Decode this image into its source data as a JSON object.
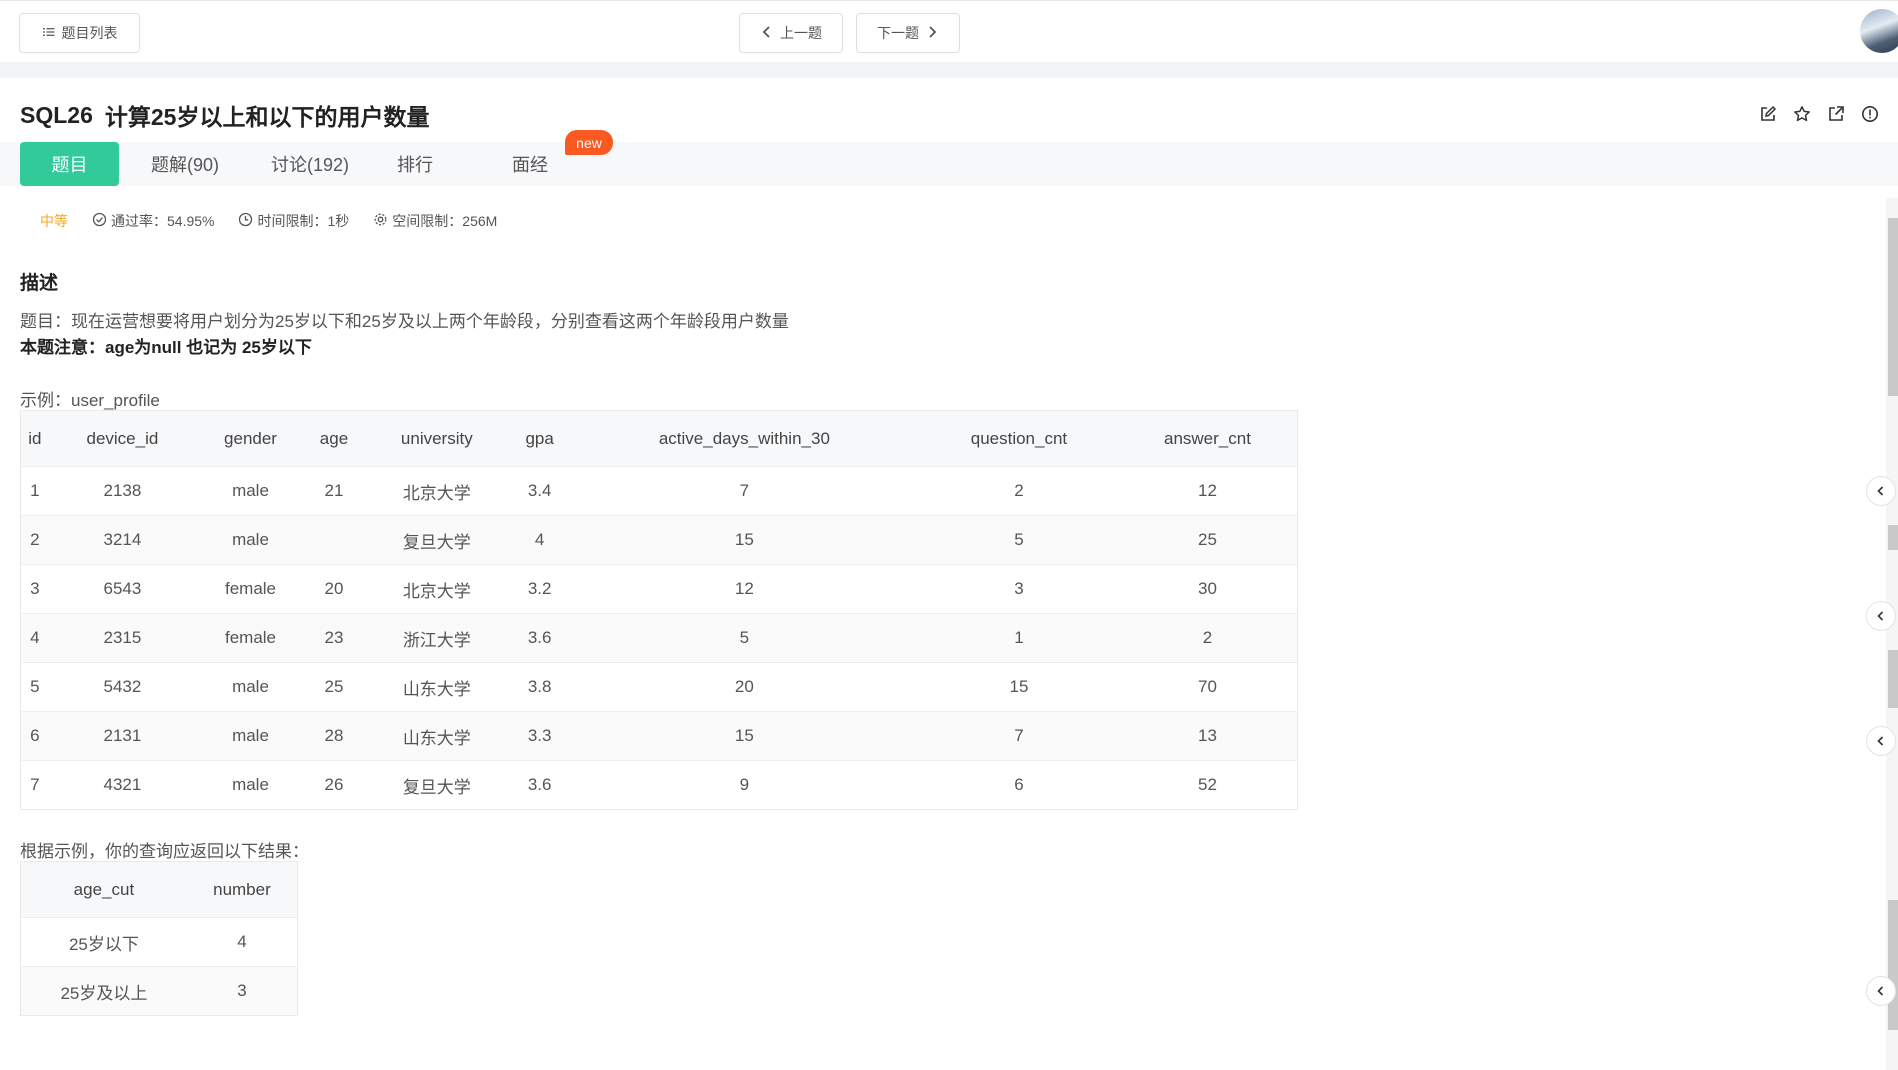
{
  "topbar": {
    "list_label": "题目列表",
    "prev_label": "上一题",
    "next_label": "下一题"
  },
  "question": {
    "id": "SQL26",
    "title": "计算25岁以上和以下的用户数量"
  },
  "tabs": {
    "problem": "题目",
    "solution": "题解(90)",
    "discuss": "讨论(192)",
    "rank": "排行",
    "interview": "面经",
    "new_badge": "new"
  },
  "meta": {
    "difficulty": "中等",
    "pass_rate": "通过率：54.95%",
    "time_limit": "时间限制：1秒",
    "space_limit": "空间限制：256M"
  },
  "description": {
    "heading": "描述",
    "line1": "题目：现在运营想要将用户划分为25岁以下和25岁及以上两个年龄段，分别查看这两个年龄段用户数量",
    "line2": "本题注意：age为null 也记为 25岁以下",
    "example_label": "示例：user_profile",
    "result_label": "根据示例，你的查询应返回以下结果："
  },
  "example_table": {
    "columns": [
      "id",
      "device_id",
      "gender",
      "age",
      "university",
      "gpa",
      "active_days_within_30",
      "question_cnt",
      "answer_cnt"
    ],
    "rows": [
      [
        "1",
        "2138",
        "male",
        "21",
        "北京大学",
        "3.4",
        "7",
        "2",
        "12"
      ],
      [
        "2",
        "3214",
        "male",
        "",
        "复旦大学",
        "4",
        "15",
        "5",
        "25"
      ],
      [
        "3",
        "6543",
        "female",
        "20",
        "北京大学",
        "3.2",
        "12",
        "3",
        "30"
      ],
      [
        "4",
        "2315",
        "female",
        "23",
        "浙江大学",
        "3.6",
        "5",
        "1",
        "2"
      ],
      [
        "5",
        "5432",
        "male",
        "25",
        "山东大学",
        "3.8",
        "20",
        "15",
        "70"
      ],
      [
        "6",
        "2131",
        "male",
        "28",
        "山东大学",
        "3.3",
        "15",
        "7",
        "13"
      ],
      [
        "7",
        "4321",
        "male",
        "26",
        "复旦大学",
        "3.6",
        "9",
        "6",
        "52"
      ]
    ]
  },
  "result_table": {
    "columns": [
      "age_cut",
      "number"
    ],
    "rows": [
      [
        "25岁以下",
        "4"
      ],
      [
        "25岁及以上",
        "3"
      ]
    ]
  },
  "colors": {
    "accent": "#32ca99",
    "badge": "#fa5a21",
    "difficulty": "#f5a623"
  }
}
